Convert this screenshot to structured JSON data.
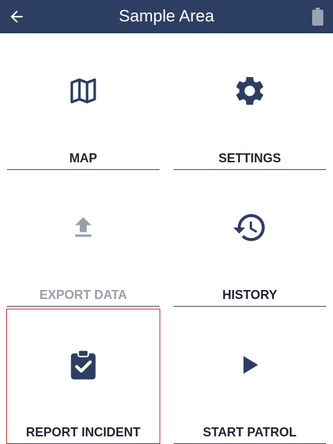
{
  "header": {
    "title": "Sample Area",
    "back_icon": "arrow-left-icon",
    "battery_icon": "battery-icon"
  },
  "colors": {
    "header_bg": "#2d3e63",
    "icon": "#2d3e63",
    "disabled": "#9aa0ab",
    "selection": "#e02020"
  },
  "tiles": [
    {
      "label": "MAP",
      "icon": "map-icon",
      "enabled": true
    },
    {
      "label": "SETTINGS",
      "icon": "gear-icon",
      "enabled": true
    },
    {
      "label": "EXPORT DATA",
      "icon": "upload-icon",
      "enabled": false
    },
    {
      "label": "HISTORY",
      "icon": "history-icon",
      "enabled": true
    },
    {
      "label": "REPORT INCIDENT",
      "icon": "clipboard-check-icon",
      "enabled": true,
      "selected": true
    },
    {
      "label": "START PATROL",
      "icon": "play-icon",
      "enabled": true
    }
  ]
}
